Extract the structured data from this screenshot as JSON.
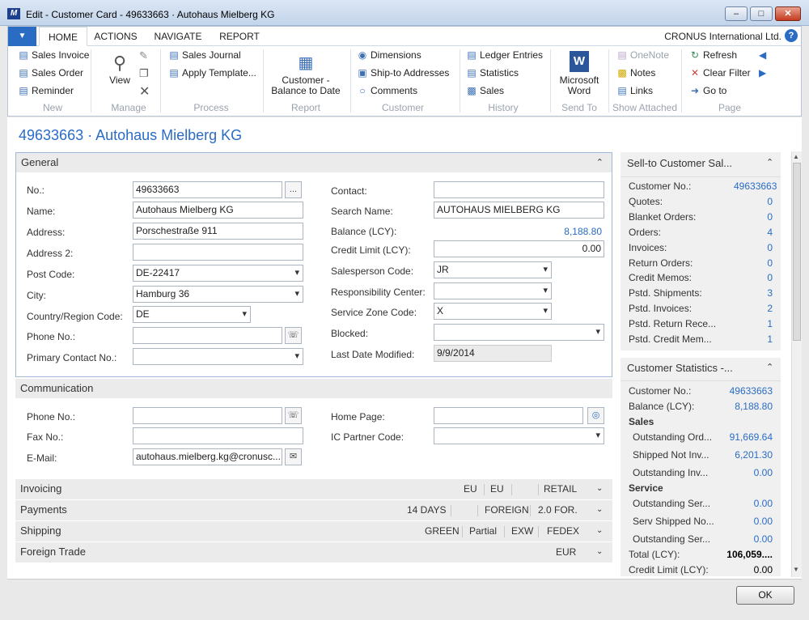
{
  "window": {
    "title": "Edit - Customer Card - 49633663 · Autohaus Mielberg KG",
    "app_icon_text": "Edit"
  },
  "ribbon": {
    "tabs": [
      "HOME",
      "ACTIONS",
      "NAVIGATE",
      "REPORT"
    ],
    "company": "CRONUS International Ltd.",
    "new": {
      "sales_invoice": "Sales Invoice",
      "sales_order": "Sales Order",
      "reminder": "Reminder",
      "group": "New"
    },
    "manage": {
      "view": "View",
      "group": "Manage"
    },
    "process": {
      "sales_journal": "Sales Journal",
      "apply_template": "Apply Template...",
      "group": "Process"
    },
    "report": {
      "balance_line1": "Customer -",
      "balance_line2": "Balance to Date",
      "group": "Report"
    },
    "customer": {
      "dimensions": "Dimensions",
      "ship_to": "Ship-to Addresses",
      "comments": "Comments",
      "group": "Customer"
    },
    "history": {
      "ledger": "Ledger Entries",
      "statistics": "Statistics",
      "sales": "Sales",
      "group": "History"
    },
    "send_to": {
      "word_line1": "Microsoft",
      "word_line2": "Word",
      "group": "Send To"
    },
    "attached": {
      "onenote": "OneNote",
      "notes": "Notes",
      "links": "Links",
      "group": "Show Attached"
    },
    "page": {
      "refresh": "Refresh",
      "clear_filter": "Clear Filter",
      "goto": "Go to",
      "group": "Page"
    }
  },
  "heading": "49633663 · Autohaus Mielberg KG",
  "general": {
    "title": "General",
    "no_label": "No.:",
    "no": "49633663",
    "name_label": "Name:",
    "name": "Autohaus Mielberg KG",
    "address_label": "Address:",
    "address": "Porschestraße 911",
    "address2_label": "Address 2:",
    "address2": "",
    "postcode_label": "Post Code:",
    "postcode": "DE-22417",
    "city_label": "City:",
    "city": "Hamburg 36",
    "country_label": "Country/Region Code:",
    "country": "DE",
    "phone_label": "Phone No.:",
    "phone": "",
    "primary_label": "Primary Contact No.:",
    "primary": "",
    "contact_label": "Contact:",
    "contact": "",
    "search_label": "Search Name:",
    "search": "AUTOHAUS MIELBERG KG",
    "balance_label": "Balance (LCY):",
    "balance": "8,188.80",
    "credit_label": "Credit Limit (LCY):",
    "credit": "0.00",
    "salesperson_label": "Salesperson Code:",
    "salesperson": "JR",
    "resp_label": "Responsibility Center:",
    "resp": "",
    "service_label": "Service Zone Code:",
    "service": "X",
    "blocked_label": "Blocked:",
    "blocked": "",
    "modified_label": "Last Date Modified:",
    "modified": "9/9/2014",
    "ellipsis": "..."
  },
  "communication": {
    "title": "Communication",
    "phone_label": "Phone No.:",
    "phone": "",
    "fax_label": "Fax No.:",
    "fax": "",
    "email_label": "E-Mail:",
    "email": "autohaus.mielberg.kg@cronusc...",
    "home_label": "Home Page:",
    "home": "",
    "ic_label": "IC Partner Code:",
    "ic": ""
  },
  "collapsed": [
    {
      "title": "Invoicing",
      "values": [
        "EU",
        "EU",
        "",
        "RETAIL"
      ]
    },
    {
      "title": "Payments",
      "values": [
        "14 DAYS",
        "",
        "FOREIGN",
        "2.0 FOR."
      ]
    },
    {
      "title": "Shipping",
      "values": [
        "GREEN",
        "Partial",
        "EXW",
        "FEDEX"
      ]
    },
    {
      "title": "Foreign Trade",
      "values": [
        "EUR"
      ]
    }
  ],
  "factbox_sales": {
    "title": "Sell-to Customer Sal...",
    "rows": [
      {
        "label": "Customer No.:",
        "value": "49633663"
      },
      {
        "label": "Quotes:",
        "value": "0"
      },
      {
        "label": "Blanket Orders:",
        "value": "0"
      },
      {
        "label": "Orders:",
        "value": "4"
      },
      {
        "label": "Invoices:",
        "value": "0"
      },
      {
        "label": "Return Orders:",
        "value": "0"
      },
      {
        "label": "Credit Memos:",
        "value": "0"
      },
      {
        "label": "Pstd. Shipments:",
        "value": "3"
      },
      {
        "label": "Pstd. Invoices:",
        "value": "2"
      },
      {
        "label": "Pstd. Return Rece...",
        "value": "1"
      },
      {
        "label": "Pstd. Credit Mem...",
        "value": "1"
      }
    ]
  },
  "factbox_stats": {
    "title": "Customer Statistics -...",
    "customer_label": "Customer No.:",
    "customer": "49633663",
    "balance_label": "Balance (LCY):",
    "balance": "8,188.80",
    "sales_heading": "Sales",
    "sales_rows": [
      {
        "label": "Outstanding Ord...",
        "value": "91,669.64"
      },
      {
        "label": "Shipped Not Inv...",
        "value": "6,201.30"
      },
      {
        "label": "Outstanding Inv...",
        "value": "0.00"
      }
    ],
    "service_heading": "Service",
    "service_rows": [
      {
        "label": "Outstanding Ser...",
        "value": "0.00"
      },
      {
        "label": "Serv Shipped No...",
        "value": "0.00"
      },
      {
        "label": "Outstanding Ser...",
        "value": "0.00"
      }
    ],
    "total_label": "Total (LCY):",
    "total": "106,059....",
    "credit_label": "Credit Limit (LCY):",
    "credit": "0.00"
  },
  "ok_label": "OK"
}
